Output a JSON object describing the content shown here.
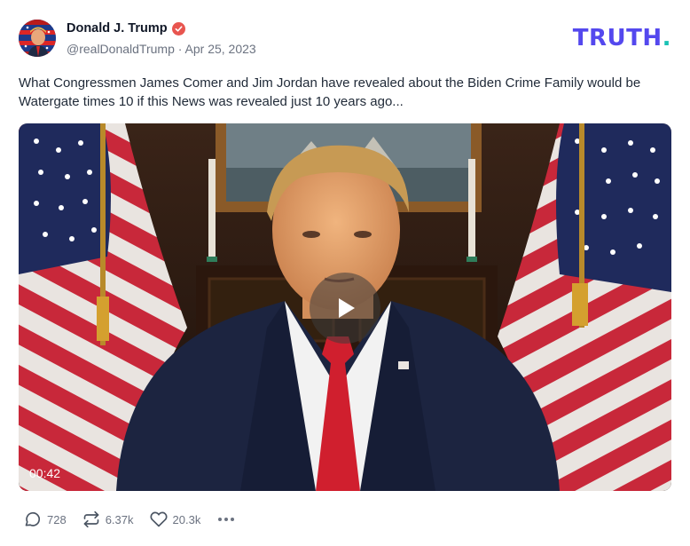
{
  "author": {
    "name": "Donald J. Trump",
    "handle": "@realDonaldTrump",
    "date": "Apr 25, 2023",
    "verified_color": "#e8554f"
  },
  "brand": {
    "logo_text": "TRUTH",
    "logo_dot": ".",
    "primary_color": "#5448ee",
    "dot_color": "#19c2b4"
  },
  "post": {
    "text": "What Congressmen James Comer and Jim Jordan have revealed about the Biden Crime Family would be Watergate times 10 if this News was revealed just 10 years ago..."
  },
  "video": {
    "duration": "00:42",
    "play_icon": "play-icon"
  },
  "actions": {
    "replies": "728",
    "retruths": "6.37k",
    "likes": "20.3k",
    "reply_icon": "comment-icon",
    "retruth_icon": "repost-icon",
    "like_icon": "heart-icon",
    "more_icon": "more-options-icon"
  }
}
